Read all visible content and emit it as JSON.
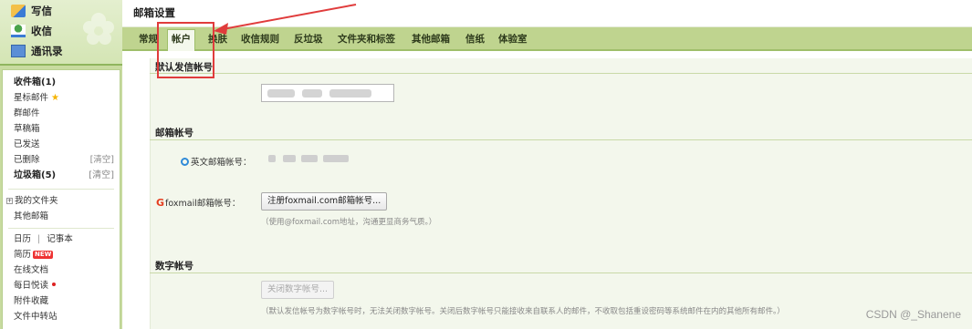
{
  "sidebar": {
    "actions": {
      "write": "写信",
      "inbox": "收信",
      "contacts": "通讯录"
    },
    "folders": {
      "inbox": "收件箱(1)",
      "starred": "星标邮件",
      "group": "群邮件",
      "drafts": "草稿箱",
      "sent": "已发送",
      "deleted": "已删除",
      "deleted_clear": "[清空]",
      "spam": "垃圾箱(5)",
      "spam_clear": "[清空]",
      "my_folders": "我的文件夹",
      "other_mailbox": "其他邮箱"
    },
    "tools": {
      "calendar": "日历",
      "divider": "|",
      "notebook": "记事本",
      "resume": "简历",
      "new_badge": "NEW",
      "docs": "在线文档",
      "daily_reading": "每日悦读",
      "attachments": "附件收藏",
      "file_transfer": "文件中转站"
    }
  },
  "header": {
    "title": "邮箱设置"
  },
  "tabs": [
    {
      "label": "常规"
    },
    {
      "label": "帐户"
    },
    {
      "label": "换肤"
    },
    {
      "label": "收信规则"
    },
    {
      "label": "反垃圾"
    },
    {
      "label": "文件夹和标签"
    },
    {
      "label": "其他邮箱"
    },
    {
      "label": "信纸"
    },
    {
      "label": "体验室"
    }
  ],
  "sections": {
    "default_sender": {
      "title": "默认发信帐号"
    },
    "mail_account": {
      "title": "邮箱帐号",
      "english_label": "英文邮箱帐号：",
      "foxmail_label": "foxmail邮箱帐号：",
      "foxmail_button": "注册foxmail.com邮箱帐号...",
      "foxmail_hint": "（使用@foxmail.com地址，沟通更显商务气质。）"
    },
    "digital_account": {
      "title": "数字帐号",
      "close_button": "关闭数字帐号...",
      "hint": "（默认发信帐号为数字帐号时，无法关闭数字帐号。关闭后数字帐号只能接收来自联系人的邮件，不收取包括重设密码等系统邮件在内的其他所有邮件。）"
    }
  },
  "watermark": "CSDN @_Shanene",
  "colors": {
    "accent_green": "#bfd48f",
    "highlight_red": "#e03c3c"
  }
}
